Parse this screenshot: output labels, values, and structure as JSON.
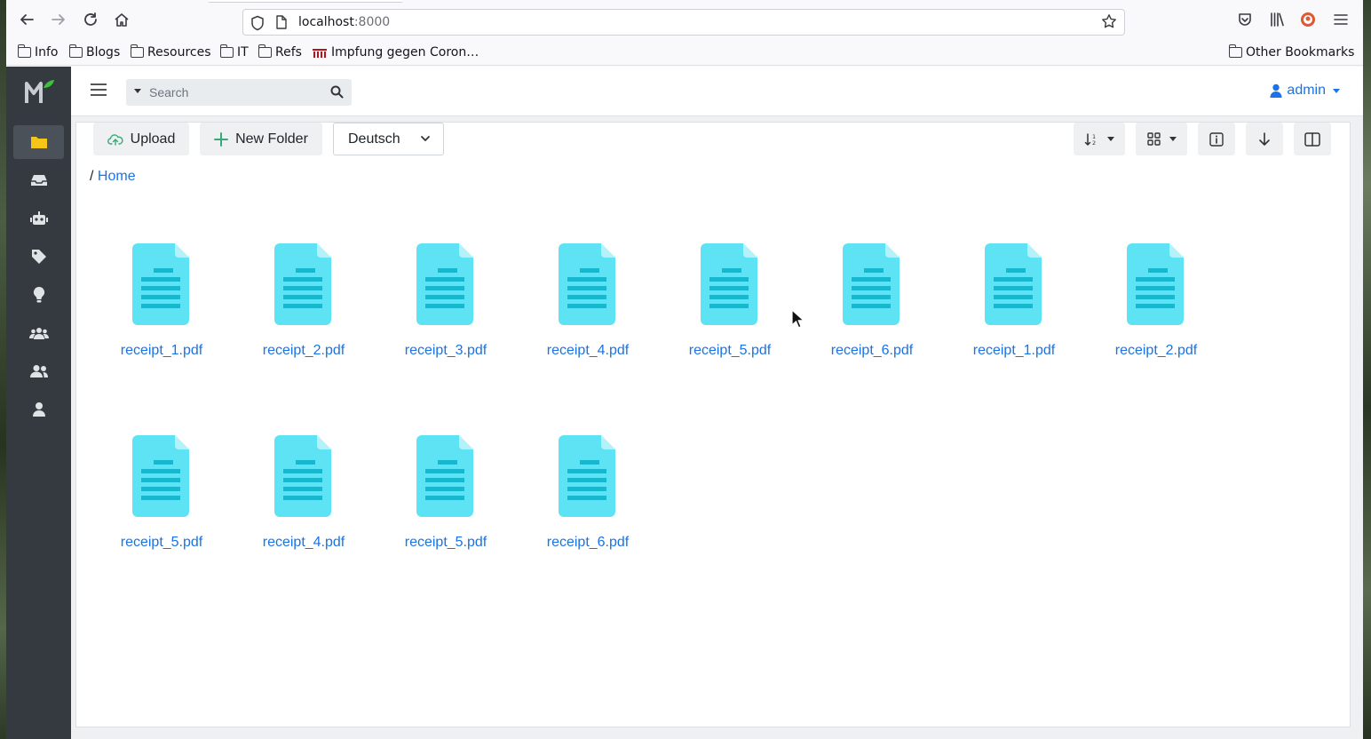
{
  "browser": {
    "url_host": "localhost",
    "url_port": ":8000",
    "bookmarks": [
      {
        "label": "Info",
        "type": "folder"
      },
      {
        "label": "Blogs",
        "type": "folder"
      },
      {
        "label": "Resources",
        "type": "folder"
      },
      {
        "label": "IT",
        "type": "folder"
      },
      {
        "label": "Refs",
        "type": "folder"
      },
      {
        "label": "Impfung gegen Coron…",
        "type": "link"
      }
    ],
    "other_bookmarks": "Other Bookmarks"
  },
  "sidebar": {
    "items": [
      {
        "icon": "folder-icon",
        "active": true
      },
      {
        "icon": "inbox-icon",
        "active": false
      },
      {
        "icon": "robot-icon",
        "active": false
      },
      {
        "icon": "tags-icon",
        "active": false
      },
      {
        "icon": "lightbulb-icon",
        "active": false
      },
      {
        "icon": "users-group-icon",
        "active": false
      },
      {
        "icon": "user-friends-icon",
        "active": false
      },
      {
        "icon": "user-icon",
        "active": false
      }
    ]
  },
  "topnav": {
    "search_placeholder": "Search",
    "user_label": "admin"
  },
  "actions": {
    "upload_label": "Upload",
    "new_folder_label": "New Folder",
    "language_selected": "Deutsch"
  },
  "breadcrumb": {
    "separator": "/",
    "home_label": "Home"
  },
  "files": [
    {
      "name": "receipt_1.pdf"
    },
    {
      "name": "receipt_2.pdf"
    },
    {
      "name": "receipt_3.pdf"
    },
    {
      "name": "receipt_4.pdf"
    },
    {
      "name": "receipt_5.pdf"
    },
    {
      "name": "receipt_6.pdf"
    },
    {
      "name": "receipt_1.pdf"
    },
    {
      "name": "receipt_2.pdf"
    },
    {
      "name": "receipt_5.pdf"
    },
    {
      "name": "receipt_4.pdf"
    },
    {
      "name": "receipt_5.pdf"
    },
    {
      "name": "receipt_6.pdf"
    }
  ],
  "colors": {
    "accent": "#1a73e8",
    "sidebar_bg": "#343a40",
    "file_icon": "#5ee3f5",
    "file_icon_lines": "#17b8cf",
    "active_folder": "#f5c518"
  }
}
